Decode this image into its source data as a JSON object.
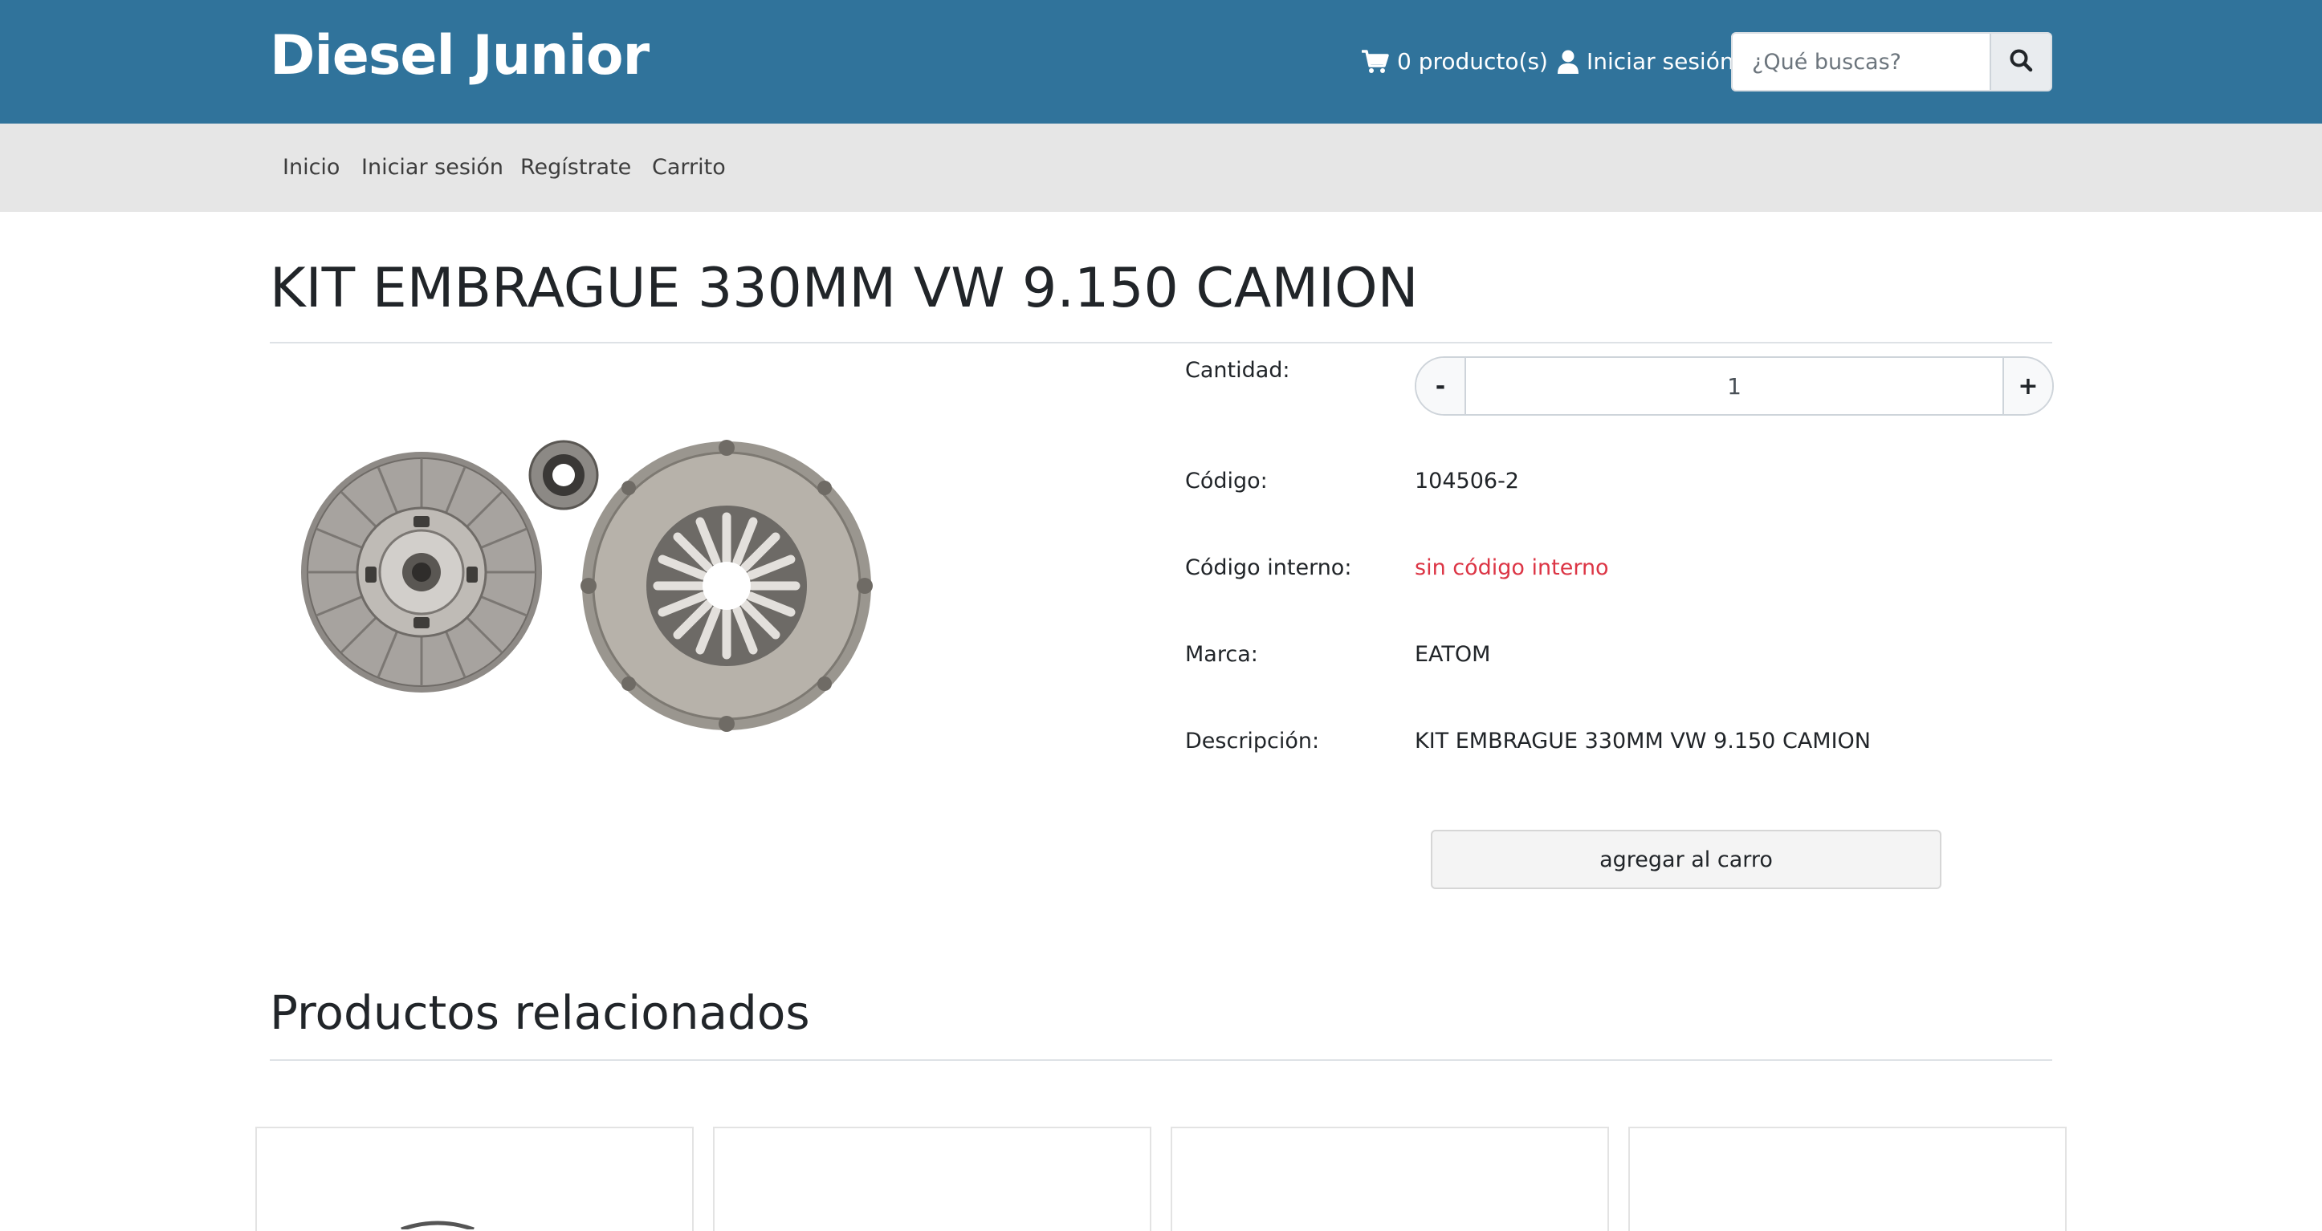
{
  "header": {
    "brand": "Diesel Junior",
    "cart_label": "0 producto(s)",
    "login_label": "Iniciar sesión",
    "search": {
      "placeholder": "¿Qué buscas?"
    },
    "icons": {
      "cart": "cart-icon",
      "user": "user-icon",
      "search": "search-icon"
    }
  },
  "nav": {
    "items": [
      {
        "label": "Inicio"
      },
      {
        "label": "Iniciar sesión"
      },
      {
        "label": "Regístrate"
      },
      {
        "label": "Carrito"
      }
    ]
  },
  "product": {
    "title": "KIT EMBRAGUE 330MM VW 9.150 CAMION",
    "quantity": {
      "label": "Cantidad:",
      "value": "1",
      "minus": "-",
      "plus": "+"
    },
    "details": [
      {
        "label": "Código:",
        "value": "104506-2"
      },
      {
        "label": "Código interno:",
        "value": "sin código interno"
      },
      {
        "label": "Marca:",
        "value": "EATOM"
      },
      {
        "label": "Descripción:",
        "value": "KIT EMBRAGUE 330MM VW 9.150 CAMION"
      }
    ],
    "add_to_cart": "agregar al carro"
  },
  "related": {
    "title": "Productos relacionados",
    "cards": 4
  },
  "colors": {
    "header_bg": "#30739b",
    "nav_bg": "#e6e6e6",
    "warning_text": "#dc3545"
  }
}
